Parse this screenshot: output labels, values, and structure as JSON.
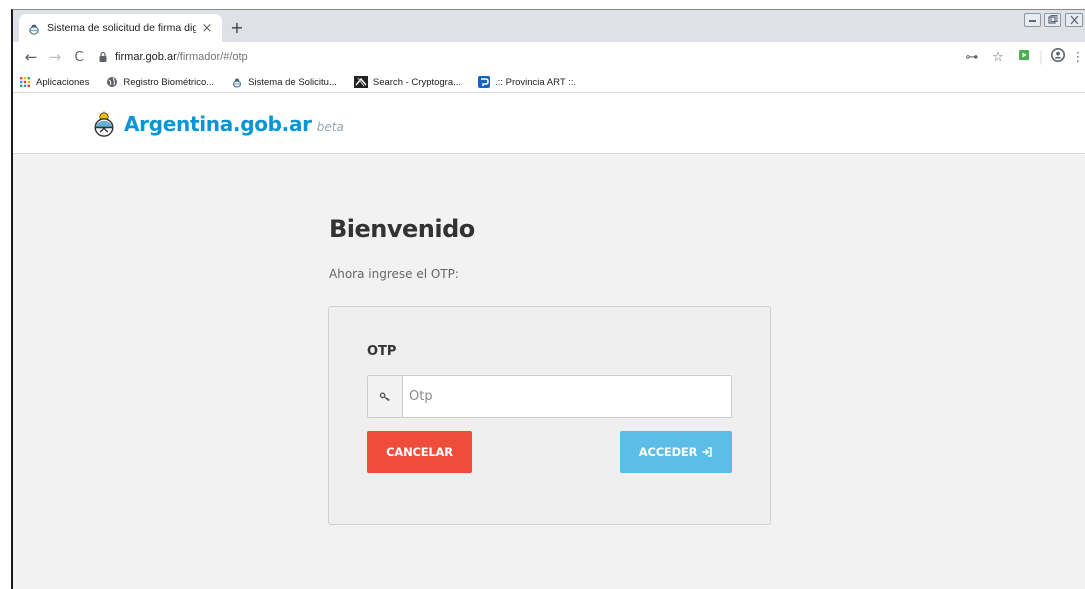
{
  "browser": {
    "tab": {
      "title": "Sistema de solicitud de firma dig",
      "close_glyph": "×",
      "favicon": "argentina-seal-icon"
    },
    "new_tab_glyph": "+",
    "window_controls": [
      "minimize-icon",
      "restore-icon",
      "close-icon"
    ],
    "toolbar": {
      "back": "←",
      "forward": "→",
      "reload": "C",
      "url_host": "firmar.gob.ar",
      "url_path": "/firmador/#/otp",
      "right_icons": {
        "key": "⊶",
        "star": "☆",
        "menu": "⋮"
      }
    },
    "bookmarks": [
      {
        "label": "Aplicaciones",
        "icon": "apps-grid-icon"
      },
      {
        "label": "Registro Biométrico...",
        "icon": "globe-icon"
      },
      {
        "label": "Sistema de Solicitu...",
        "icon": "argentina-seal-icon"
      },
      {
        "label": "Search - Cryptogra...",
        "icon": "cryptography-icon"
      },
      {
        "label": ".:: Provincia ART ::.",
        "icon": "provincia-art-icon"
      }
    ]
  },
  "site": {
    "brand_name": "Argentina.gob.ar",
    "brand_tag": "beta"
  },
  "main": {
    "title": "Bienvenido",
    "subtitle": "Ahora ingrese el OTP:",
    "form": {
      "label": "OTP",
      "input_placeholder": "Otp",
      "input_value": "",
      "cancel_label": "CANCELAR",
      "accept_label": "ACCEDER"
    }
  },
  "colors": {
    "brand": "#0695d6",
    "cancel": "#f04c3b",
    "accept": "#5bbde8",
    "background": "#f2f2f2"
  }
}
